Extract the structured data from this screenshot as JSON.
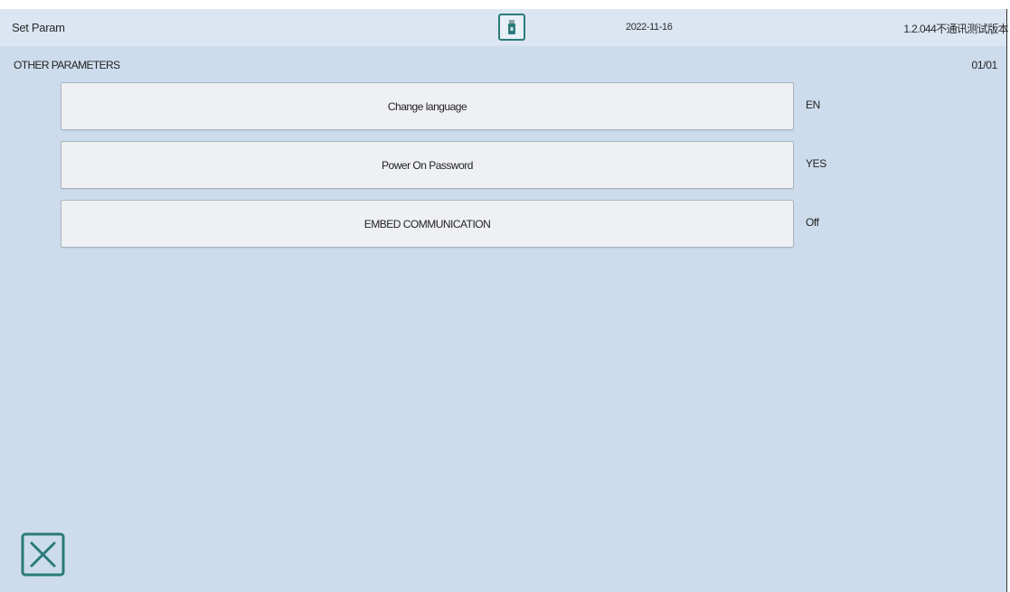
{
  "header": {
    "title": "Set Param",
    "usb_icon": "usb-drive-icon",
    "date": "2022-11-16",
    "version": "1.2.044不通讯测试版本"
  },
  "section": {
    "title": "OTHER PARAMETERS",
    "page": "01/01"
  },
  "params": [
    {
      "label": "Change language",
      "value": "EN"
    },
    {
      "label": "Power On Password",
      "value": "YES"
    },
    {
      "label": "EMBED COMMUNICATION",
      "value": "Off"
    }
  ],
  "footer": {
    "close_icon": "close-icon"
  },
  "colors": {
    "background": "#cddcec",
    "header": "#dce6f2",
    "accent": "#2a7b7b",
    "button": "#eef0f3"
  }
}
